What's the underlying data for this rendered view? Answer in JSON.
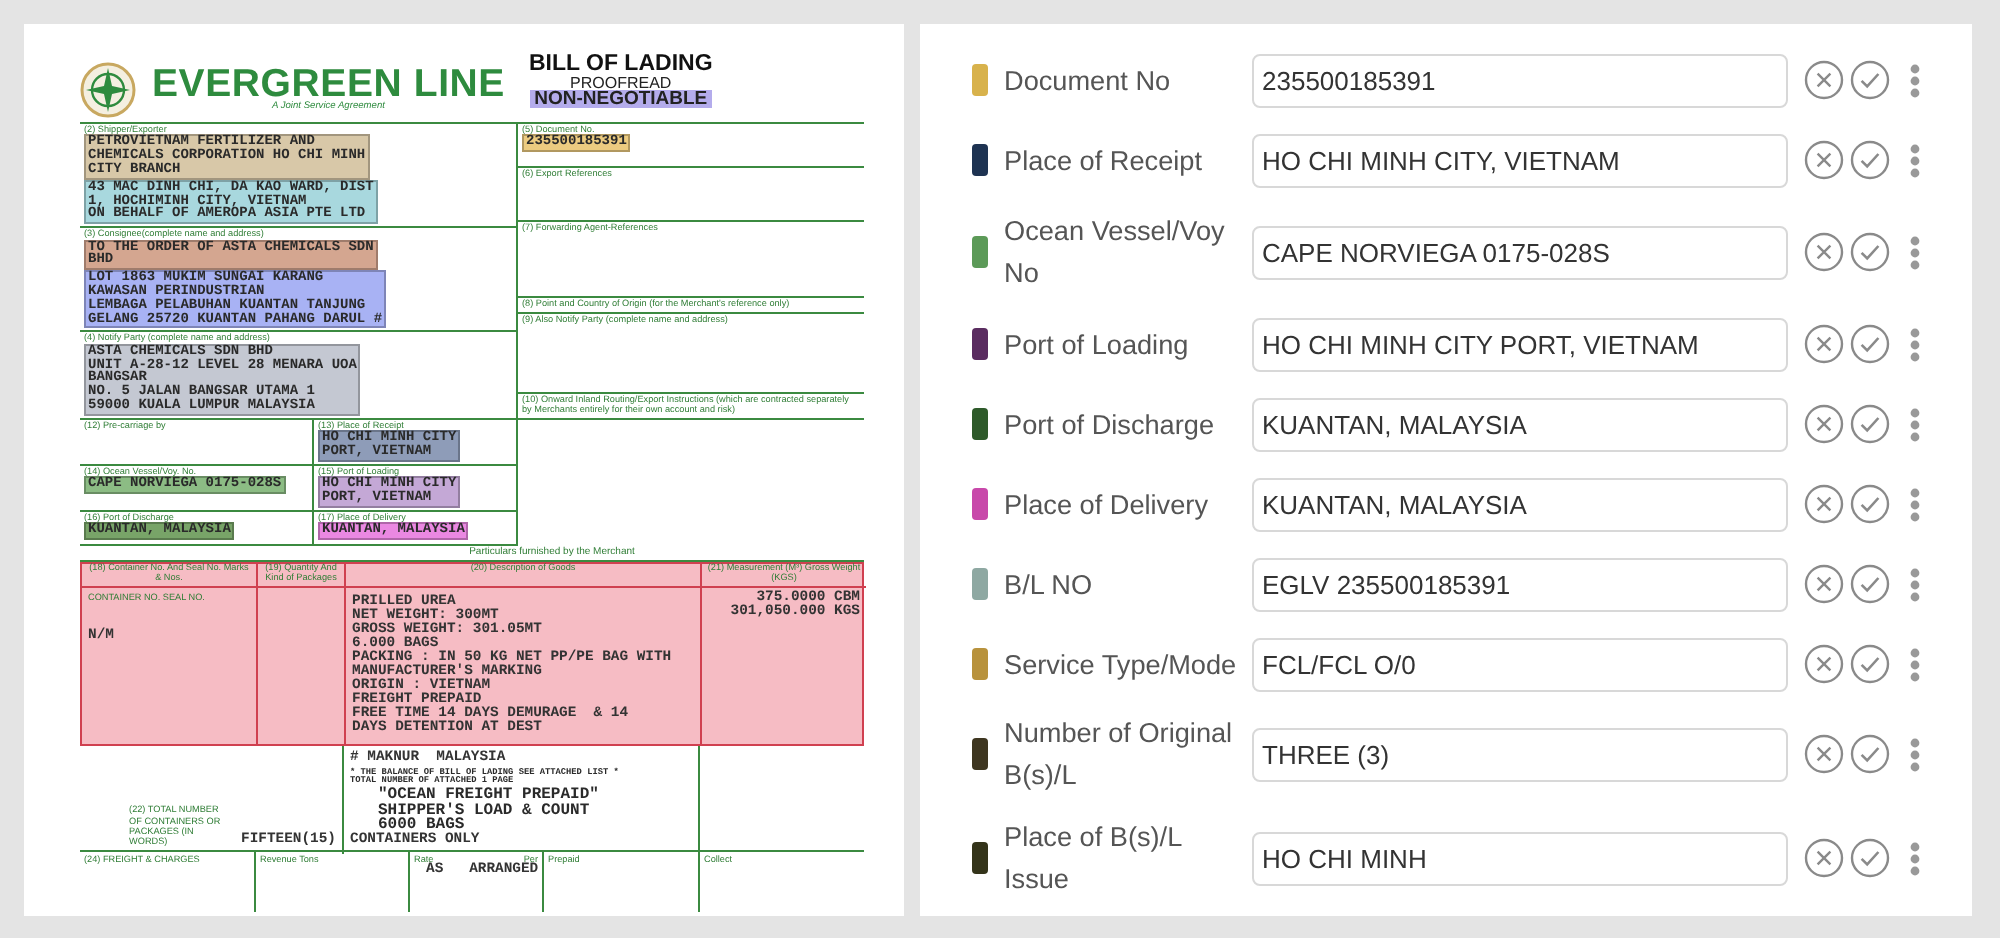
{
  "document": {
    "header": {
      "brand": "EVERGREEN LINE",
      "tagline": "A Joint Service Agreement",
      "title": "BILL OF LADING",
      "subtitle": "PROOFREAD",
      "status": {
        "text": "NON-NEGOTIABLE",
        "color": "#b4acec"
      }
    },
    "upper_left": [
      {
        "label": "(2) Shipper/Exporter",
        "blocks": [
          {
            "lines": [
              "PETROVIETNAM FERTILIZER AND",
              "CHEMICALS CORPORATION HO CHI MINH",
              "CITY BRANCH"
            ],
            "color": "#d8c8a8"
          },
          {
            "lines": [
              "43 MAC DINH CHI, DA KAO WARD, DIST",
              "1, HOCHIMINH CITY, VIETNAM",
              "ON BEHALF OF AMEROPA ASIA PTE LTD"
            ],
            "color": "#a8d8de"
          }
        ]
      },
      {
        "label": "(3) Consignee(complete name and address)",
        "blocks": [
          {
            "lines": [
              "TO THE ORDER OF ASTA CHEMICALS SDN",
              "BHD"
            ],
            "color": "#d4a690"
          },
          {
            "lines": [
              "LOT 1863 MUKIM SUNGAI KARANG",
              "KAWASAN PERINDUSTRIAN",
              "LEMBAGA PELABUHAN KUANTAN TANJUNG",
              "GELANG 25720 KUANTAN PAHANG DARUL #"
            ],
            "color": "#a8b2f4"
          }
        ]
      },
      {
        "label": "(4) Notify Party (complete name and address)",
        "blocks": [
          {
            "lines": [
              "ASTA CHEMICALS SDN BHD",
              "UNIT A-28-12 LEVEL 28 MENARA UOA",
              "BANGSAR",
              "NO. 5 JALAN BANGSAR UTAMA 1",
              "59000 KUALA LUMPUR MALAYSIA"
            ],
            "color": "#c4c8d2"
          }
        ]
      }
    ],
    "routing_grid": [
      {
        "label": "(12) Pre-carriage by"
      },
      {
        "label": "(13) Place of Receipt",
        "blocks": [
          {
            "lines": [
              "HO CHI MINH CITY",
              "PORT, VIETNAM"
            ],
            "color": "#8e9cb8"
          }
        ]
      },
      {
        "label": "(14) Ocean Vessel/Voy. No.",
        "blocks": [
          {
            "lines": [
              "CAPE NORVIEGA 0175-028S"
            ],
            "color": "#8cbc84"
          }
        ]
      },
      {
        "label": "(15) Port of Loading",
        "blocks": [
          {
            "lines": [
              "HO CHI MINH CITY",
              "PORT, VIETNAM"
            ],
            "color": "#c4a8d6"
          }
        ]
      },
      {
        "label": "(16) Port of Discharge",
        "blocks": [
          {
            "lines": [
              "KUANTAN, MALAYSIA"
            ],
            "color": "#78a468"
          }
        ]
      },
      {
        "label": "(17) Place of Delivery",
        "blocks": [
          {
            "lines": [
              "KUANTAN, MALAYSIA"
            ],
            "color": "#ea88e2"
          }
        ]
      }
    ],
    "upper_right": [
      {
        "label": "(5) Document No.",
        "blocks": [
          {
            "lines": [
              "235500185391"
            ],
            "color": "#eccb80"
          }
        ]
      },
      {
        "label": "(6) Export References"
      },
      {
        "label": "(7) Forwarding Agent-References"
      },
      {
        "label": "(8) Point and Country of Origin (for the Merchant's reference only)"
      },
      {
        "label": "(9) Also Notify Party (complete name and address)"
      },
      {
        "label": "(10) Onward Inland Routing/Export Instructions (which are contracted separately by Merchants entirely for their own account and risk)"
      }
    ],
    "particulars_title": "Particulars furnished by the Merchant",
    "goods_columns": [
      "(18) Container No. And Seal No. Marks & Nos.",
      "(19) Quantity And Kind of Packages",
      "(20) Description of Goods",
      "(21) Measurement (M³) Gross Weight (KGS)"
    ],
    "goods": {
      "color": "#f6bcc4",
      "marks_heading": "CONTAINER NO. SEAL NO.",
      "marks": "N/M",
      "description": [
        "PRILLED UREA",
        "NET WEIGHT: 300MT",
        "GROSS WEIGHT: 301.05MT",
        "6.000 BAGS",
        "PACKING : IN 50 KG NET PP/PE BAG WITH",
        "MANUFACTURER'S MARKING",
        "ORIGIN : VIETNAM",
        "FREIGHT PREPAID",
        "FREE TIME 14 DAYS DEMURAGE  & 14",
        "DAYS DETENTION AT DEST"
      ],
      "measurement": [
        "375.0000 CBM",
        "301,050.000 KGS"
      ]
    },
    "notes": {
      "heading": "# MAKNUR  MALAYSIA",
      "small": [
        "* THE BALANCE OF BILL OF LADING SEE ATTACHED LIST *",
        "TOTAL NUMBER OF ATTACHED 1 PAGE"
      ],
      "lines": [
        "\"OCEAN FREIGHT PREPAID\"",
        "SHIPPER'S LOAD & COUNT",
        "6000 BAGS"
      ]
    },
    "total_packages": {
      "label": "(22) TOTAL NUMBER OF CONTAINERS OR PACKAGES (IN WORDS)",
      "count": "FIFTEEN(15)",
      "words": "CONTAINERS ONLY"
    },
    "freight": {
      "charges": "(24) FREIGHT & CHARGES",
      "revenue": "Revenue Tons",
      "rate": "Rate",
      "rate_value": "AS   ARRANGED",
      "per": "Per",
      "prepaid": "Prepaid",
      "collect": "Collect"
    }
  },
  "fields": [
    {
      "label": "Document No",
      "value": "235500185391",
      "color": "#d8b24c"
    },
    {
      "label": "Place of Receipt",
      "value": "HO CHI MINH CITY, VIETNAM",
      "color": "#1e3352"
    },
    {
      "label": "Ocean Vessel/Voy No",
      "value": "CAPE NORVIEGA 0175-028S",
      "color": "#5c9a58"
    },
    {
      "label": "Port of Loading",
      "value": "HO CHI MINH CITY PORT, VIETNAM",
      "color": "#5a2c60"
    },
    {
      "label": "Port of Discharge",
      "value": "KUANTAN, MALAYSIA",
      "color": "#2e5a2a"
    },
    {
      "label": "Place of Delivery",
      "value": "KUANTAN, MALAYSIA",
      "color": "#c848aa"
    },
    {
      "label": "B/L NO",
      "value": "EGLV 235500185391",
      "color": "#8ea8a2"
    },
    {
      "label": "Service Type/Mode",
      "value": "FCL/FCL O/0",
      "color": "#b8923c"
    },
    {
      "label": "Number of Original B(s)/L",
      "value": "THREE (3)",
      "color": "#3e3620"
    },
    {
      "label": "Place of B(s)/L Issue",
      "value": "HO CHI MINH",
      "color": "#34341a"
    }
  ]
}
